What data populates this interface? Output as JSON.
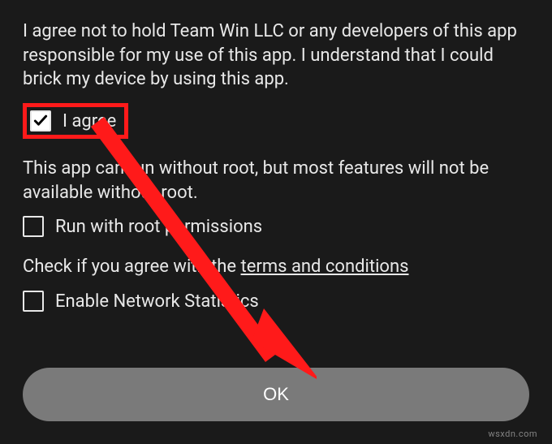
{
  "disclaimer": "I agree not to hold Team Win LLC or any developers of this app responsible for my use of this app. I understand that I could brick my device by using this app.",
  "agree": {
    "label": "I agree",
    "checked": true
  },
  "rootNotice": "This app can run without root, but most features will not be available without root.",
  "rootCheckbox": {
    "label": "Run with root permissions",
    "checked": false
  },
  "termsNotice": {
    "prefix": "Check if you agree with the ",
    "link": "terms and conditions"
  },
  "networkCheckbox": {
    "label": "Enable Network Statistics",
    "checked": false
  },
  "okButton": "OK",
  "watermark": "wsxdn.com"
}
